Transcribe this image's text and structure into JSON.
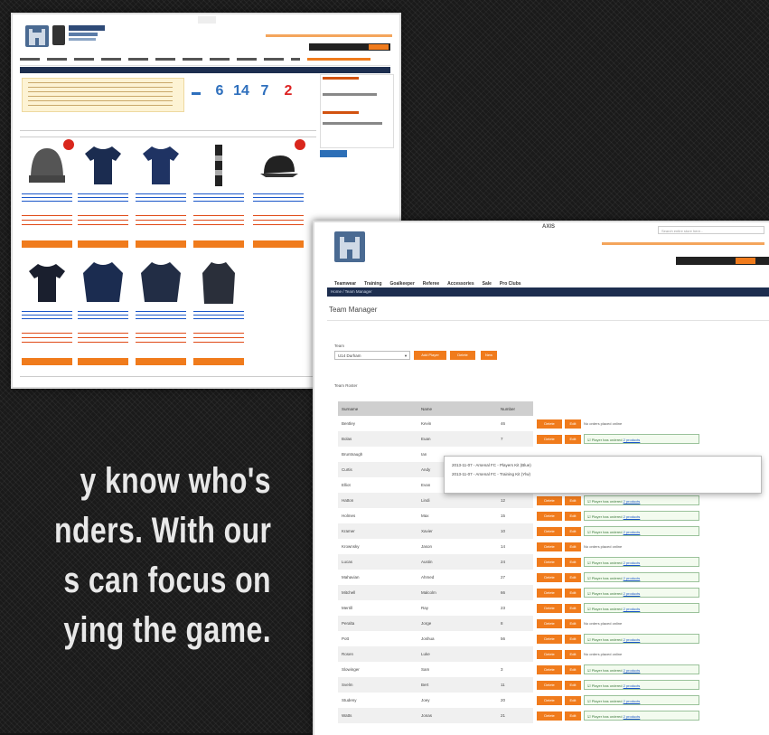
{
  "tagline": {
    "line1": "y know who's",
    "line2": "nders. With our",
    "line3": "s can focus on",
    "line4": "ying the game."
  },
  "colors": {
    "accent": "#f07b1c",
    "navy": "#1d2e4f",
    "link": "#1a56c9",
    "stat": "#2e6fbd",
    "stat_alert": "#d22222"
  },
  "shop": {
    "stats": [
      "6",
      "14",
      "7",
      "2"
    ],
    "products": [
      {
        "icon": "beanie-icon",
        "sale": true
      },
      {
        "icon": "shirt-icon",
        "sale": false
      },
      {
        "icon": "shirt-icon",
        "sale": false
      },
      {
        "icon": "scarf-icon",
        "sale": false
      },
      {
        "icon": "cap-icon",
        "sale": true
      },
      {
        "icon": "shirt-icon",
        "sale": false
      },
      {
        "icon": "jacket-icon",
        "sale": false
      },
      {
        "icon": "jacket-icon",
        "sale": false
      },
      {
        "icon": "coat-icon",
        "sale": false
      }
    ]
  },
  "team_manager": {
    "brand_badge": "AXIS",
    "title": "Team Manager",
    "breadcrumb": "Home / Team Manager",
    "search_placeholder": "Search entire store here...",
    "team_label": "Team",
    "team_selected": "U14 Durham",
    "roster_label": "Team Roster",
    "nav": [
      "Teamwear",
      "Training",
      "Goalkeeper",
      "Referee",
      "Accessories",
      "Sale",
      "Pro Clubs"
    ],
    "columns": [
      "Surname",
      "Name",
      "Number"
    ],
    "popup": [
      "2013-11-07 - Arsenal FC - Players Kit (Blue)",
      "2013-11-07 - Arsenal FC - Training Kit (Ylw)"
    ],
    "rows": [
      {
        "surname": "Bentley",
        "name": "Kevin",
        "number": "46",
        "ordered": false
      },
      {
        "surname": "Bolas",
        "name": "Euan",
        "number": "7",
        "ordered": true
      },
      {
        "surname": "Bruntnaugh",
        "name": "Ian",
        "number": "",
        "ordered": false,
        "popup": true
      },
      {
        "surname": "Curtis",
        "name": "Andy",
        "number": "",
        "ordered": false,
        "popup": true
      },
      {
        "surname": "Elliot",
        "name": "Evan",
        "number": "6",
        "ordered": false
      },
      {
        "surname": "Hatton",
        "name": "Lindi",
        "number": "12",
        "ordered": true
      },
      {
        "surname": "Holmes",
        "name": "Max",
        "number": "15",
        "ordered": true
      },
      {
        "surname": "Kramer",
        "name": "Xavier",
        "number": "10",
        "ordered": true
      },
      {
        "surname": "Krownsky",
        "name": "Jason",
        "number": "14",
        "ordered": false
      },
      {
        "surname": "Lucas",
        "name": "Austin",
        "number": "24",
        "ordered": true
      },
      {
        "surname": "Mahavian",
        "name": "Ahmed",
        "number": "27",
        "ordered": true
      },
      {
        "surname": "Mitchell",
        "name": "Malcolm",
        "number": "66",
        "ordered": true
      },
      {
        "surname": "Merrill",
        "name": "Ray",
        "number": "23",
        "ordered": true
      },
      {
        "surname": "Peralta",
        "name": "Jorge",
        "number": "8",
        "ordered": false
      },
      {
        "surname": "Pott",
        "name": "Joshua",
        "number": "56",
        "ordered": true
      },
      {
        "surname": "Rosen",
        "name": "Luke",
        "number": "",
        "ordered": false
      },
      {
        "surname": "Slowinger",
        "name": "Sam",
        "number": "3",
        "ordered": true
      },
      {
        "surname": "Svelm",
        "name": "Bert",
        "number": "11",
        "ordered": true
      },
      {
        "surname": "Studeny",
        "name": "Joey",
        "number": "20",
        "ordered": true
      },
      {
        "surname": "Watts",
        "name": "Jonas",
        "number": "21",
        "ordered": true
      }
    ],
    "btn_delete": "Delete",
    "btn_edit": "Edit",
    "status_none": "No orders placed online",
    "status_ordered": "Player has ordered",
    "status_link": "2 products",
    "team_buttons": [
      "Add Player",
      "Delete",
      "New"
    ]
  }
}
